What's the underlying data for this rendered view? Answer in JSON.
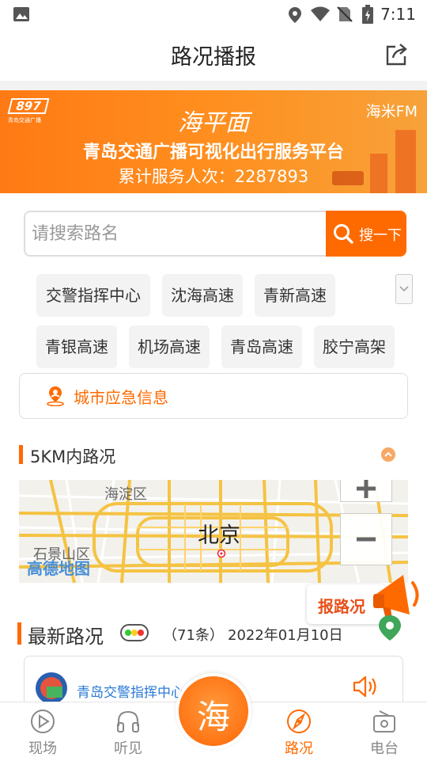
{
  "status_bar": {
    "time": "7:11"
  },
  "header": {
    "title": "路况播报"
  },
  "banner": {
    "logo": "897",
    "logo_sub": "青岛交通广播",
    "brand": "海平面",
    "fm": "海米FM",
    "platform": "青岛交通广播可视化出行服务平台",
    "served_label": "累计服务人次：",
    "served_count": "2287893"
  },
  "search": {
    "placeholder": "请搜索路名",
    "button": "搜一下"
  },
  "road_chips": [
    "交警指挥中心",
    "沈海高速",
    "青新高速",
    "青银高速",
    "机场高速",
    "青岛高速",
    "胶宁高架"
  ],
  "emergency": {
    "label": "城市应急信息"
  },
  "nearby": {
    "title": "5KM内路况"
  },
  "map": {
    "city": "北京",
    "district_1": "海淀区",
    "district_2": "石景山区",
    "provider": "高德地图"
  },
  "report": {
    "label": "报路况"
  },
  "latest": {
    "title": "最新路况",
    "count": "（71条）",
    "date": "2022年01月10日"
  },
  "card": {
    "name": "青岛交警指挥中心"
  },
  "tabs": [
    {
      "label": "现场",
      "active": false
    },
    {
      "label": "听见",
      "active": false
    },
    {
      "label": "路况",
      "active": true
    },
    {
      "label": "电台",
      "active": false
    }
  ],
  "center_tab": {
    "label": "海"
  },
  "colors": {
    "accent": "#ff6a00",
    "link": "#2a7ad6"
  }
}
